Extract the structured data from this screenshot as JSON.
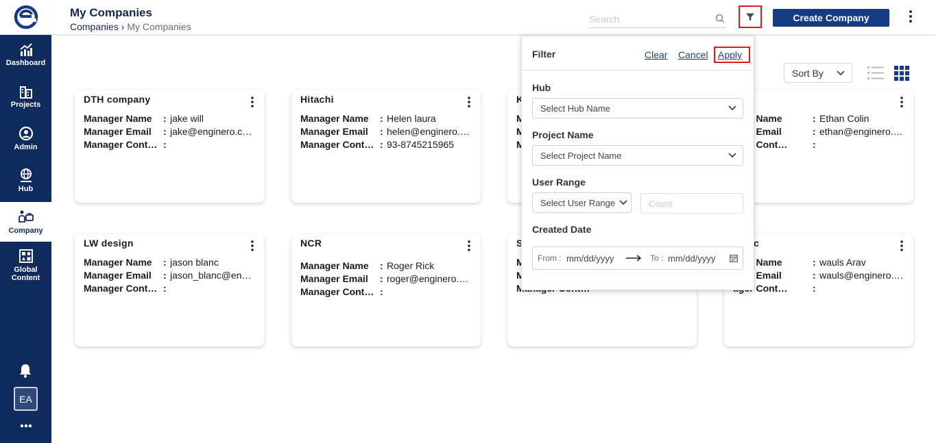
{
  "header": {
    "title": "My Companies",
    "breadcrumb": {
      "root": "Companies",
      "separator": "›",
      "current": "My Companies"
    },
    "search_placeholder": "Search",
    "create_label": "Create Company"
  },
  "sidebar": {
    "items": [
      {
        "label": "Dashboard",
        "icon": "chart-up-icon"
      },
      {
        "label": "Projects",
        "icon": "buildings-icon"
      },
      {
        "label": "Admin",
        "icon": "user-circle-icon"
      },
      {
        "label": "Hub",
        "icon": "globe-hub-icon"
      },
      {
        "label": "Company",
        "icon": "company-icon"
      },
      {
        "label": "Global Content",
        "icon": "content-grid-icon"
      }
    ],
    "avatar": "EA"
  },
  "toolbar": {
    "sort_label": "Sort By"
  },
  "cards": [
    {
      "title": "DTH company",
      "rows": [
        {
          "k": "Manager Name",
          "v": "jake will"
        },
        {
          "k": "Manager Email",
          "v": "jake@enginero.c…"
        },
        {
          "k": "Manager Cont…",
          "v": ""
        }
      ]
    },
    {
      "title": "Hitachi",
      "rows": [
        {
          "k": "Manager Name",
          "v": "Helen laura"
        },
        {
          "k": "Manager Email",
          "v": "helen@enginero.…"
        },
        {
          "k": "Manager Cont…",
          "v": "93-8745215965"
        }
      ]
    },
    {
      "title": "K",
      "rows": [
        {
          "k": "M",
          "v": ""
        },
        {
          "k": "M",
          "v": ""
        },
        {
          "k": "M",
          "v": ""
        }
      ]
    },
    {
      "title": "",
      "rows": [
        {
          "k": "ager Name",
          "v": "Ethan Colin"
        },
        {
          "k": "ager Email",
          "v": "ethan@enginero.…"
        },
        {
          "k": "ager Cont…",
          "v": ""
        }
      ]
    },
    {
      "title": "LW design",
      "rows": [
        {
          "k": "Manager Name",
          "v": "jason blanc"
        },
        {
          "k": "Manager Email",
          "v": "jason_blanc@en…"
        },
        {
          "k": "Manager Cont…",
          "v": ""
        }
      ]
    },
    {
      "title": "NCR",
      "rows": [
        {
          "k": "Manager Name",
          "v": "Roger Rick"
        },
        {
          "k": "Manager Email",
          "v": "roger@enginero.…"
        },
        {
          "k": "Manager Cont…",
          "v": ""
        }
      ]
    },
    {
      "title": "S",
      "rows": [
        {
          "k": "M",
          "v": ""
        },
        {
          "k": "M",
          "v": ""
        },
        {
          "k": "Manager Cont…",
          "v": ""
        }
      ]
    },
    {
      "title": "antec",
      "rows": [
        {
          "k": "ager Name",
          "v": "wauls Arav"
        },
        {
          "k": "ager Email",
          "v": "wauls@enginero.…"
        },
        {
          "k": "ager Cont…",
          "v": ""
        }
      ]
    }
  ],
  "filter": {
    "title": "Filter",
    "clear": "Clear",
    "cancel": "Cancel",
    "apply": "Apply",
    "hub_label": "Hub",
    "hub_placeholder": "Select Hub Name",
    "project_label": "Project Name",
    "project_placeholder": "Select Project Name",
    "range_label": "User Range",
    "range_placeholder": "Select User Range",
    "count_placeholder": "Count",
    "date_label": "Created Date",
    "from_label": "From :",
    "from_placeholder": "mm/dd/yyyy",
    "to_label": "To :",
    "to_placeholder": "mm/dd/yyyy"
  },
  "colors": {
    "sidebar": "#0f2a5c",
    "primary": "#163b82",
    "highlight": "#e0191b"
  }
}
